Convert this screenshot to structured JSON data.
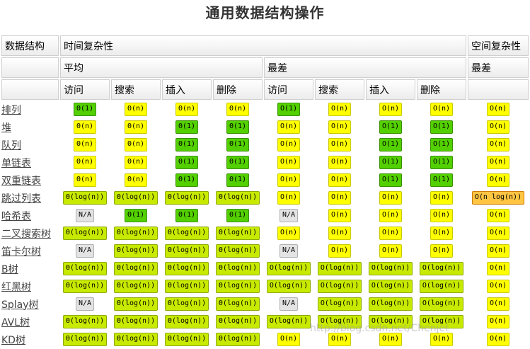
{
  "title": "通用数据结构操作",
  "headers": {
    "ds": "数据结构",
    "time": "时间复杂性",
    "space": "空间复杂性",
    "average": "平均",
    "worst": "最差",
    "space_worst": "最差",
    "ops": [
      "访问",
      "搜索",
      "插入",
      "删除",
      "访问",
      "搜索",
      "插入",
      "删除"
    ]
  },
  "colors": {
    "green": "#53d000",
    "lime": "#c8ea00",
    "yellow": "#ffff00",
    "orange": "#ffc543",
    "gray": "#e3e3e3"
  },
  "rows": [
    {
      "name": "排列",
      "cells": [
        [
          "Θ(1)",
          "green"
        ],
        [
          "Θ(n)",
          "yellow"
        ],
        [
          "Θ(n)",
          "yellow"
        ],
        [
          "Θ(n)",
          "yellow"
        ],
        [
          "O(1)",
          "green"
        ],
        [
          "O(n)",
          "yellow"
        ],
        [
          "O(n)",
          "yellow"
        ],
        [
          "O(n)",
          "yellow"
        ],
        [
          "O(n)",
          "yellow"
        ]
      ]
    },
    {
      "name": "堆",
      "cells": [
        [
          "Θ(n)",
          "yellow"
        ],
        [
          "Θ(n)",
          "yellow"
        ],
        [
          "Θ(1)",
          "green"
        ],
        [
          "Θ(1)",
          "green"
        ],
        [
          "O(n)",
          "yellow"
        ],
        [
          "O(n)",
          "yellow"
        ],
        [
          "O(1)",
          "green"
        ],
        [
          "O(1)",
          "green"
        ],
        [
          "O(n)",
          "yellow"
        ]
      ]
    },
    {
      "name": "队列",
      "cells": [
        [
          "Θ(n)",
          "yellow"
        ],
        [
          "Θ(n)",
          "yellow"
        ],
        [
          "Θ(1)",
          "green"
        ],
        [
          "Θ(1)",
          "green"
        ],
        [
          "O(n)",
          "yellow"
        ],
        [
          "O(n)",
          "yellow"
        ],
        [
          "O(1)",
          "green"
        ],
        [
          "O(1)",
          "green"
        ],
        [
          "O(n)",
          "yellow"
        ]
      ]
    },
    {
      "name": "单链表",
      "cells": [
        [
          "Θ(n)",
          "yellow"
        ],
        [
          "Θ(n)",
          "yellow"
        ],
        [
          "Θ(1)",
          "green"
        ],
        [
          "Θ(1)",
          "green"
        ],
        [
          "O(n)",
          "yellow"
        ],
        [
          "O(n)",
          "yellow"
        ],
        [
          "O(1)",
          "green"
        ],
        [
          "O(1)",
          "green"
        ],
        [
          "O(n)",
          "yellow"
        ]
      ]
    },
    {
      "name": "双重链表",
      "cells": [
        [
          "Θ(n)",
          "yellow"
        ],
        [
          "Θ(n)",
          "yellow"
        ],
        [
          "Θ(1)",
          "green"
        ],
        [
          "Θ(1)",
          "green"
        ],
        [
          "O(n)",
          "yellow"
        ],
        [
          "O(n)",
          "yellow"
        ],
        [
          "O(1)",
          "green"
        ],
        [
          "O(1)",
          "green"
        ],
        [
          "O(n)",
          "yellow"
        ]
      ]
    },
    {
      "name": "跳过列表",
      "cells": [
        [
          "Θ(log(n))",
          "lime"
        ],
        [
          "Θ(log(n))",
          "lime"
        ],
        [
          "Θ(log(n))",
          "lime"
        ],
        [
          "Θ(log(n))",
          "lime"
        ],
        [
          "O(n)",
          "yellow"
        ],
        [
          "O(n)",
          "yellow"
        ],
        [
          "O(n)",
          "yellow"
        ],
        [
          "O(n)",
          "yellow"
        ],
        [
          "O(n log(n))",
          "orange"
        ]
      ]
    },
    {
      "name": "哈希表",
      "cells": [
        [
          "N/A",
          "gray"
        ],
        [
          "Θ(1)",
          "green"
        ],
        [
          "Θ(1)",
          "green"
        ],
        [
          "Θ(1)",
          "green"
        ],
        [
          "N/A",
          "gray"
        ],
        [
          "O(n)",
          "yellow"
        ],
        [
          "O(n)",
          "yellow"
        ],
        [
          "O(n)",
          "yellow"
        ],
        [
          "O(n)",
          "yellow"
        ]
      ]
    },
    {
      "name": "二叉搜索树",
      "cells": [
        [
          "Θ(log(n))",
          "lime"
        ],
        [
          "Θ(log(n))",
          "lime"
        ],
        [
          "Θ(log(n))",
          "lime"
        ],
        [
          "Θ(log(n))",
          "lime"
        ],
        [
          "O(n)",
          "yellow"
        ],
        [
          "O(n)",
          "yellow"
        ],
        [
          "O(n)",
          "yellow"
        ],
        [
          "O(n)",
          "yellow"
        ],
        [
          "O(n)",
          "yellow"
        ]
      ]
    },
    {
      "name": "笛卡尔树",
      "cells": [
        [
          "N/A",
          "gray"
        ],
        [
          "Θ(log(n))",
          "lime"
        ],
        [
          "Θ(log(n))",
          "lime"
        ],
        [
          "Θ(log(n))",
          "lime"
        ],
        [
          "N/A",
          "gray"
        ],
        [
          "O(n)",
          "yellow"
        ],
        [
          "O(n)",
          "yellow"
        ],
        [
          "O(n)",
          "yellow"
        ],
        [
          "O(n)",
          "yellow"
        ]
      ]
    },
    {
      "name": "B树",
      "cells": [
        [
          "Θ(log(n))",
          "lime"
        ],
        [
          "Θ(log(n))",
          "lime"
        ],
        [
          "Θ(log(n))",
          "lime"
        ],
        [
          "Θ(log(n))",
          "lime"
        ],
        [
          "O(log(n))",
          "lime"
        ],
        [
          "O(log(n))",
          "lime"
        ],
        [
          "O(log(n))",
          "lime"
        ],
        [
          "O(log(n))",
          "lime"
        ],
        [
          "O(n)",
          "yellow"
        ]
      ]
    },
    {
      "name": "红黑树",
      "cells": [
        [
          "Θ(log(n))",
          "lime"
        ],
        [
          "Θ(log(n))",
          "lime"
        ],
        [
          "Θ(log(n))",
          "lime"
        ],
        [
          "Θ(log(n))",
          "lime"
        ],
        [
          "O(log(n))",
          "lime"
        ],
        [
          "O(log(n))",
          "lime"
        ],
        [
          "O(log(n))",
          "lime"
        ],
        [
          "O(log(n))",
          "lime"
        ],
        [
          "O(n)",
          "yellow"
        ]
      ]
    },
    {
      "name": "Splay树",
      "cells": [
        [
          "N/A",
          "gray"
        ],
        [
          "Θ(log(n))",
          "lime"
        ],
        [
          "Θ(log(n))",
          "lime"
        ],
        [
          "Θ(log(n))",
          "lime"
        ],
        [
          "N/A",
          "gray"
        ],
        [
          "O(log(n))",
          "lime"
        ],
        [
          "O(log(n))",
          "lime"
        ],
        [
          "O(log(n))",
          "lime"
        ],
        [
          "O(n)",
          "yellow"
        ]
      ]
    },
    {
      "name": "AVL树",
      "cells": [
        [
          "Θ(log(n))",
          "lime"
        ],
        [
          "Θ(log(n))",
          "lime"
        ],
        [
          "Θ(log(n))",
          "lime"
        ],
        [
          "Θ(log(n))",
          "lime"
        ],
        [
          "O(log(n))",
          "lime"
        ],
        [
          "O(log(n))",
          "lime"
        ],
        [
          "O(log(n))",
          "lime"
        ],
        [
          "O(log(n))",
          "lime"
        ],
        [
          "O(n)",
          "yellow"
        ]
      ]
    },
    {
      "name": "KD树",
      "cells": [
        [
          "Θ(log(n))",
          "lime"
        ],
        [
          "Θ(log(n))",
          "lime"
        ],
        [
          "Θ(log(n))",
          "lime"
        ],
        [
          "Θ(log(n))",
          "lime"
        ],
        [
          "O(n)",
          "yellow"
        ],
        [
          "O(n)",
          "yellow"
        ],
        [
          "O(n)",
          "yellow"
        ],
        [
          "O(n)",
          "yellow"
        ],
        [
          "O(n)",
          "yellow"
        ]
      ]
    }
  ],
  "watermark": "http://blog.csdn.net/Chenjet"
}
